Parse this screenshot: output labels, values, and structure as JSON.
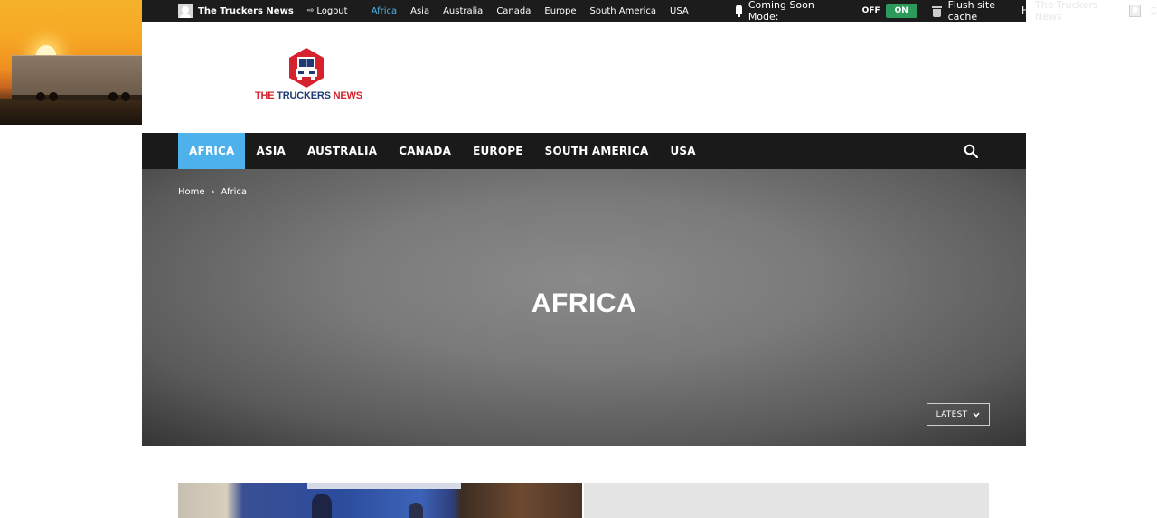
{
  "admin_bar": {
    "site_name": "The Truckers News",
    "logout_label": "Logout",
    "menu": [
      "Africa",
      "Asia",
      "Australia",
      "Canada",
      "Europe",
      "South America",
      "USA"
    ],
    "active_menu": "Africa",
    "coming_soon_label": "Coming Soon Mode:",
    "toggle_off": "OFF",
    "toggle_on": "ON",
    "flush_label": "Flush site cache",
    "howdy_text": "Howdy, The Truckers News",
    "overflow_site_name": "The Truckers News",
    "overflow_tail": "C"
  },
  "logo": {
    "text_part1": "THE ",
    "text_part2": "TRUCKERS",
    "text_part3": " NEWS",
    "colors": {
      "red": "#d6222c",
      "blue": "#1e3b73"
    }
  },
  "nav": {
    "items": [
      "AFRICA",
      "ASIA",
      "AUSTRALIA",
      "CANADA",
      "EUROPE",
      "SOUTH AMERICA",
      "USA"
    ],
    "active": "AFRICA",
    "accent_color": "#4db2ec",
    "search_icon": "search-icon"
  },
  "breadcrumb": {
    "home": "Home",
    "separator": "›",
    "current": "Africa"
  },
  "hero": {
    "title": "AFRICA",
    "sort_label": "LATEST",
    "sort_icon": "chevron-down-icon"
  }
}
